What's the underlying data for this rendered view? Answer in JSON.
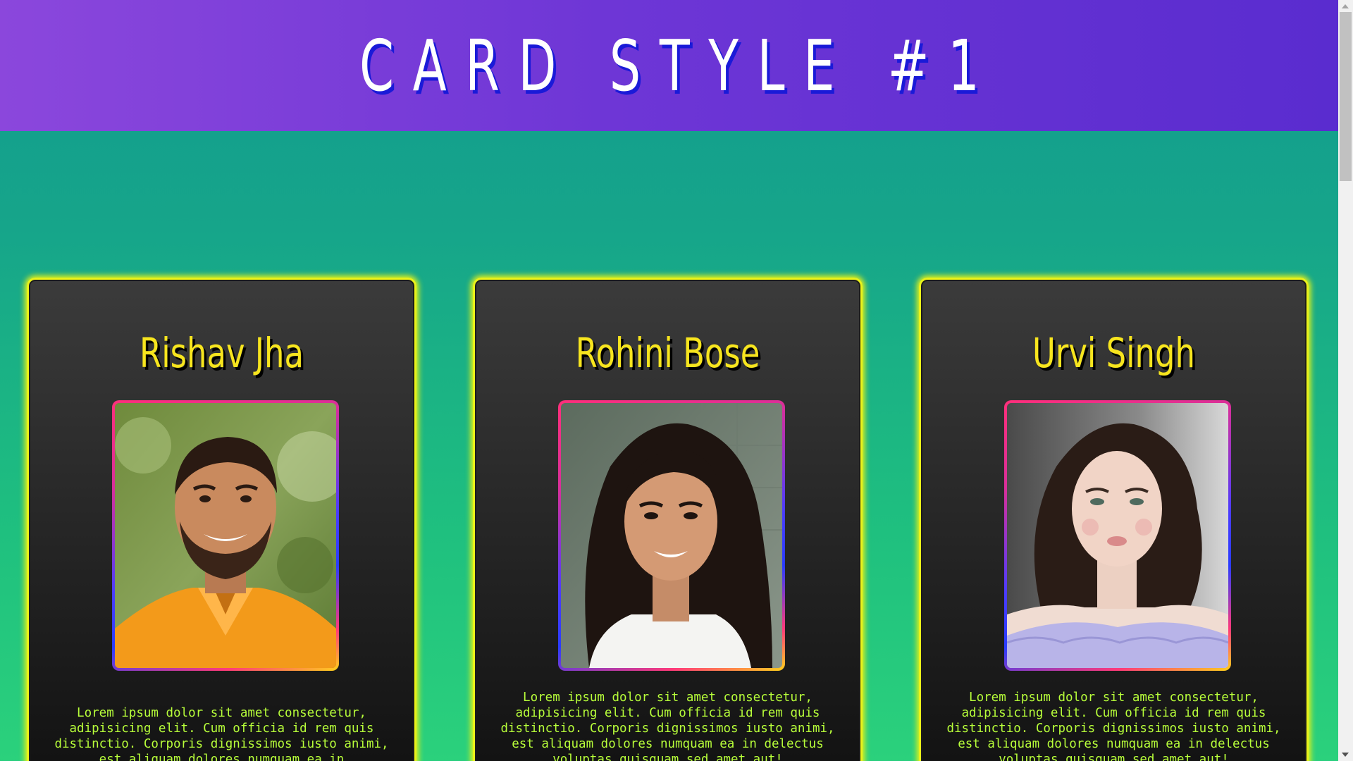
{
  "header": {
    "title": "CARD STYLE #1"
  },
  "cards": [
    {
      "name": "Rishav Jha",
      "photo_icon": "portrait-man-orange-shirt",
      "text": "Lorem ipsum dolor sit amet consectetur, adipisicing elit. Cum officia id rem quis distinctio. Corporis dignissimos iusto animi, est aliquam dolores numquam ea in"
    },
    {
      "name": "Rohini Bose",
      "photo_icon": "portrait-woman-white-top",
      "text": "Lorem ipsum dolor sit amet consectetur, adipisicing elit. Cum officia id rem quis distinctio. Corporis dignissimos iusto animi, est aliquam dolores numquam ea in delectus voluptas quisquam sed amet aut!"
    },
    {
      "name": "Urvi Singh",
      "photo_icon": "portrait-woman-lavender-top",
      "text": "Lorem ipsum dolor sit amet consectetur, adipisicing elit. Cum officia id rem quis distinctio. Corporis dignissimos iusto animi, est aliquam dolores numquam ea in delectus voluptas quisquam sed amet aut!"
    }
  ],
  "colors": {
    "banner_left": "#8b47dc",
    "banner_right": "#5a2ccf",
    "title_shadow": "#1a1ad8",
    "card_border_glow": "#eaf21a",
    "card_name": "#f7e51e",
    "card_text": "#b8ff3a",
    "background_top": "#129b8f",
    "background_bottom": "#2bd17c"
  }
}
